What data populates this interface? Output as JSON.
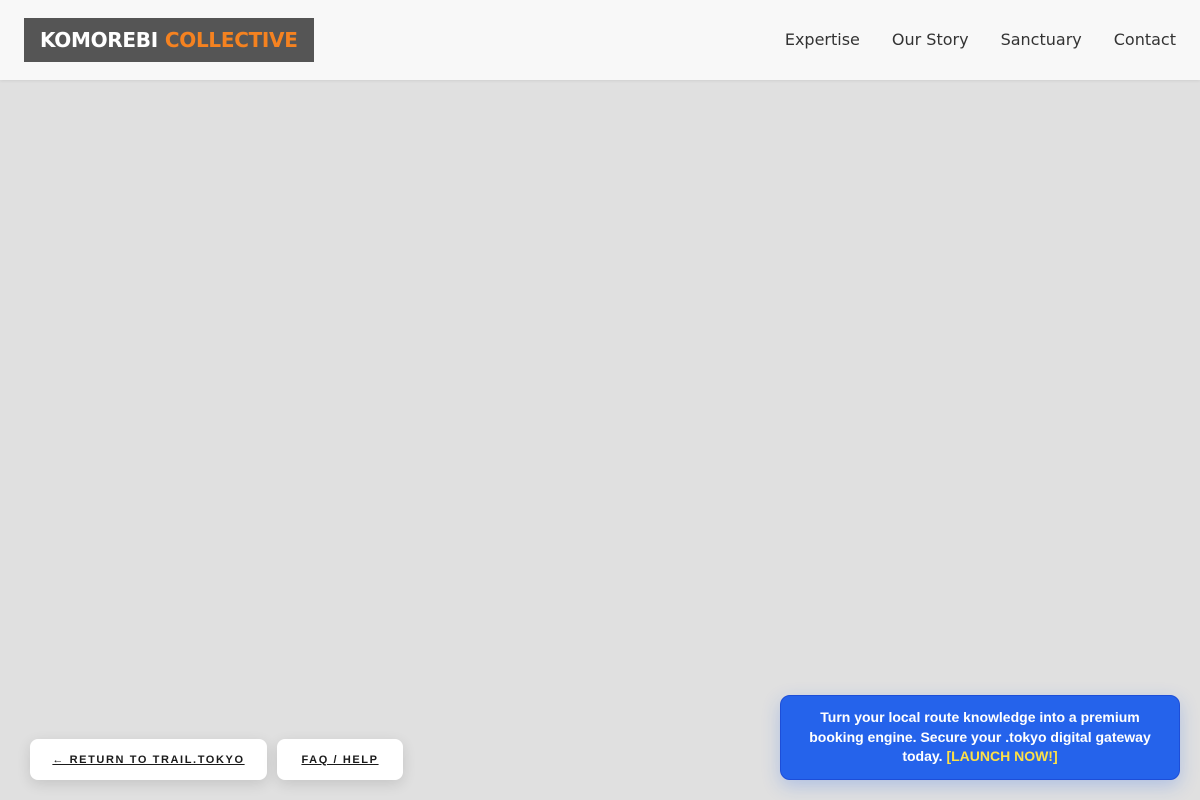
{
  "header": {
    "logo": {
      "primary": "KOMOREBI",
      "accent": "COLLECTIVE"
    },
    "nav": [
      {
        "label": "Expertise"
      },
      {
        "label": "Our Story"
      },
      {
        "label": "Sanctuary"
      },
      {
        "label": "Contact"
      }
    ]
  },
  "footer_buttons": {
    "return_label": "← RETURN TO TRAIL.TOKYO",
    "faq_label": "FAQ / HELP"
  },
  "promo": {
    "text": "Turn your local route knowledge into a premium booking engine. Secure your .tokyo digital gateway today.",
    "cta": "[LAUNCH NOW!]"
  },
  "colors": {
    "background": "#e0e0e0",
    "header_background": "#f8f8f8",
    "logo_background": "#555555",
    "logo_accent": "#f58220",
    "promo_background": "#2563eb",
    "promo_cta": "#fde047"
  }
}
